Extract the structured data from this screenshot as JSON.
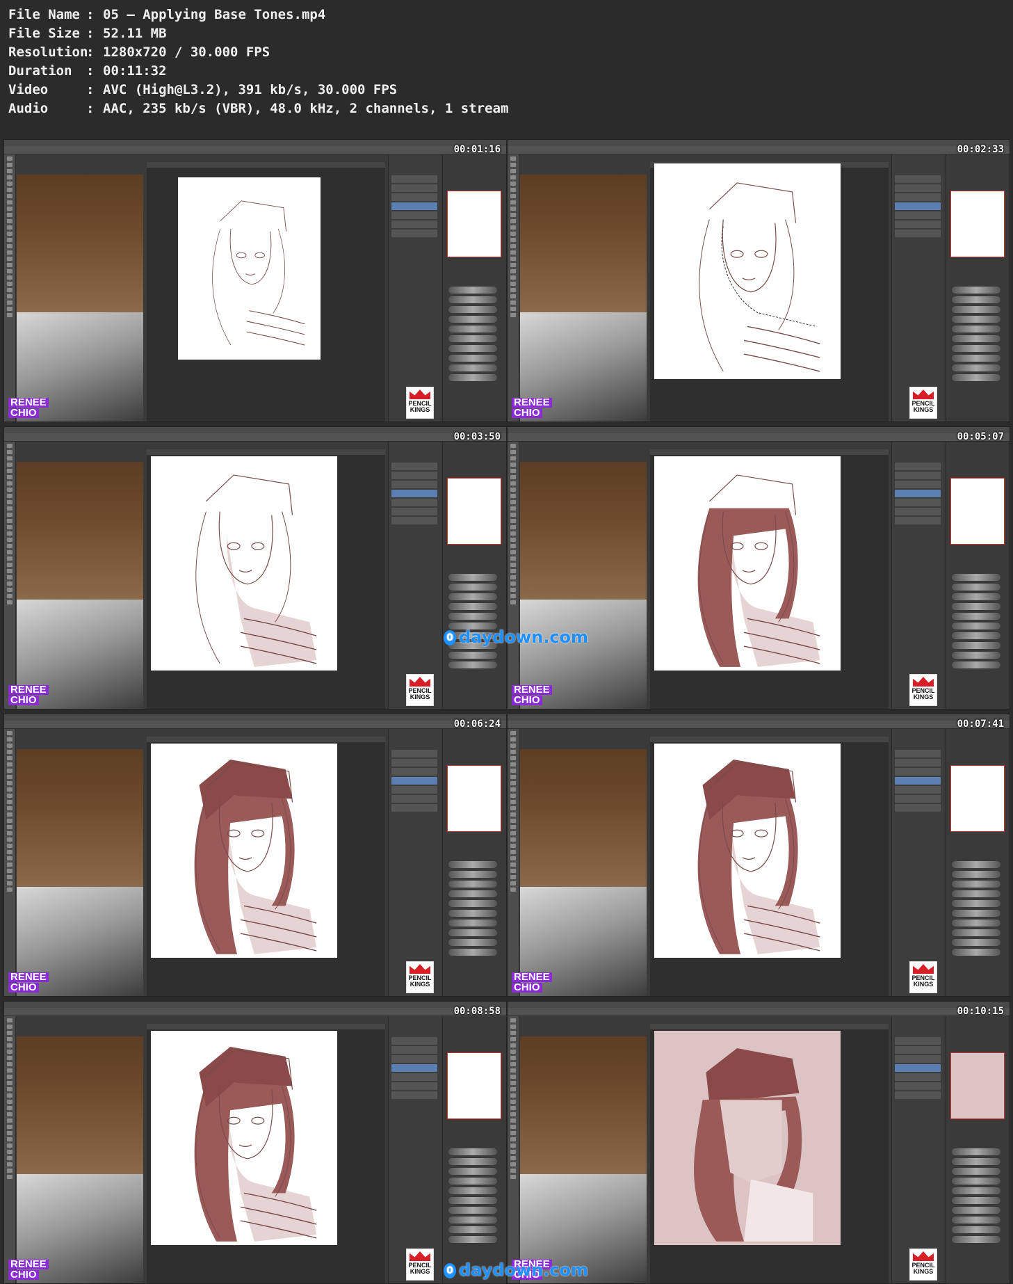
{
  "file_info": [
    {
      "key": "File Name",
      "value": "05 – Applying Base Tones.mp4"
    },
    {
      "key": "File Size",
      "value": "52.11 MB"
    },
    {
      "key": "Resolution",
      "value": "1280x720 / 30.000 FPS"
    },
    {
      "key": "Duration",
      "value": "00:11:32"
    },
    {
      "key": "Video",
      "value": "AVC (High@L3.2), 391 kb/s, 30.000 FPS"
    },
    {
      "key": "Audio",
      "value": "AAC, 235 kb/s (VBR), 48.0 kHz, 2 channels, 1 stream"
    }
  ],
  "separator": ":",
  "thumbnails": [
    {
      "timestamp": "00:01:16",
      "stage": "sketch",
      "bg": "#ffffff"
    },
    {
      "timestamp": "00:02:33",
      "stage": "selection",
      "bg": "#ffffff"
    },
    {
      "timestamp": "00:03:50",
      "stage": "skin",
      "bg": "#ffffff"
    },
    {
      "timestamp": "00:05:07",
      "stage": "hair",
      "bg": "#ffffff"
    },
    {
      "timestamp": "00:06:24",
      "stage": "hat",
      "bg": "#ffffff"
    },
    {
      "timestamp": "00:07:41",
      "stage": "hat",
      "bg": "#ffffff"
    },
    {
      "timestamp": "00:08:58",
      "stage": "hat",
      "bg": "#ffffff"
    },
    {
      "timestamp": "00:10:15",
      "stage": "flat",
      "bg": "#dcc4c4"
    }
  ],
  "logos": {
    "renee_line1": "RENEE",
    "renee_line2": "CHIO",
    "pencil_line1": "PENCIL",
    "pencil_line2": "KINGS"
  },
  "watermark": {
    "text": "daydown.com",
    "mark": "0"
  },
  "colors": {
    "hair": "#9a5a58",
    "skin": "#e6d3d3",
    "line": "#7a4a4a",
    "brand_purple": "#8a2bd4",
    "brand_red": "#d61f26"
  }
}
